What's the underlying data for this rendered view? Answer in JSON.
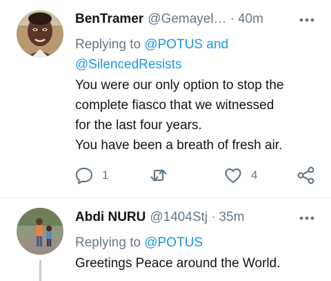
{
  "tweets": [
    {
      "display_name": "BenTramer",
      "handle": "@Gemayel…",
      "separator": "·",
      "time": "40m",
      "replying_prefix": "Replying to",
      "replying_users": "@POTUS",
      "replying_and": "and",
      "replying_users_2": "@SilencedResists",
      "text_lines": [
        "You were our only option to stop the",
        "complete fiasco that we witnessed",
        "for the last four years.",
        "You have been a breath of fresh air."
      ],
      "reply_count": "1",
      "retweet_count": "",
      "like_count": "4"
    },
    {
      "display_name": "Abdi NURU",
      "handle": "@1404Stj",
      "separator": "·",
      "time": "35m",
      "replying_prefix": "Replying to",
      "replying_users": "@POTUS",
      "text_lines": [
        "Greetings Peace around the World."
      ]
    }
  ],
  "icons": {
    "more": "more-horizontal-icon",
    "reply": "reply-bubble-icon",
    "retweet": "retweet-icon",
    "like": "heart-icon",
    "share": "share-icon"
  },
  "colors": {
    "link": "#1b95e0",
    "secondary_text": "#657786",
    "primary_text": "#0f1419",
    "divider": "#e6ecf0",
    "thread_line": "#c4cfd6"
  }
}
